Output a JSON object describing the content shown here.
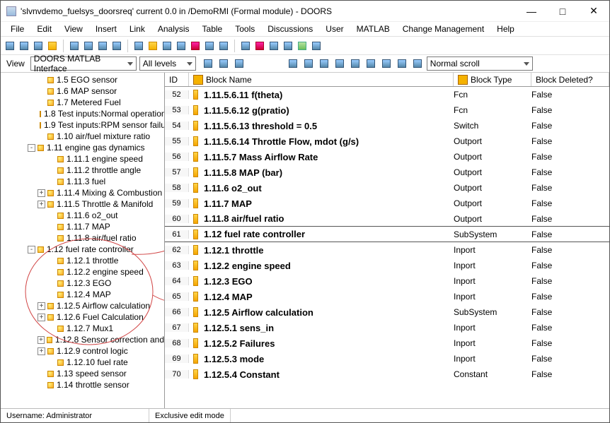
{
  "window": {
    "title": "'slvnvdemo_fuelsys_doorsreq' current 0.0 in /DemoRMI (Formal module) - DOORS"
  },
  "menu": [
    "File",
    "Edit",
    "View",
    "Insert",
    "Link",
    "Analysis",
    "Table",
    "Tools",
    "Discussions",
    "User",
    "MATLAB",
    "Change Management",
    "Help"
  ],
  "viewrow": {
    "view_label": "View",
    "view_combo": "DOORS MATLAB Interface",
    "level_combo": "All levels",
    "scroll_combo": "Normal scroll"
  },
  "tree": [
    {
      "indent": 3,
      "exp": "",
      "label": "1.5 EGO sensor"
    },
    {
      "indent": 3,
      "exp": "",
      "label": "1.6 MAP sensor"
    },
    {
      "indent": 3,
      "exp": "",
      "label": "1.7 Metered Fuel"
    },
    {
      "indent": 3,
      "exp": "",
      "label": "1.8 Test inputs:Normal operation"
    },
    {
      "indent": 3,
      "exp": "",
      "label": "1.9 Test inputs:RPM sensor failu"
    },
    {
      "indent": 3,
      "exp": "",
      "label": "1.10 air/fuel mixture ratio"
    },
    {
      "indent": 2,
      "exp": "-",
      "label": "1.11 engine gas dynamics"
    },
    {
      "indent": 4,
      "exp": "",
      "label": "1.11.1 engine speed"
    },
    {
      "indent": 4,
      "exp": "",
      "label": "1.11.2 throttle angle"
    },
    {
      "indent": 4,
      "exp": "",
      "label": "1.11.3 fuel"
    },
    {
      "indent": 3,
      "exp": "+",
      "label": "1.11.4 Mixing & Combustion"
    },
    {
      "indent": 3,
      "exp": "+",
      "label": "1.11.5 Throttle & Manifold"
    },
    {
      "indent": 4,
      "exp": "",
      "label": "1.11.6 o2_out"
    },
    {
      "indent": 4,
      "exp": "",
      "label": "1.11.7 MAP"
    },
    {
      "indent": 4,
      "exp": "",
      "label": "1.11.8 air/fuel ratio"
    },
    {
      "indent": 2,
      "exp": "-",
      "label": "1.12 fuel rate controller"
    },
    {
      "indent": 4,
      "exp": "",
      "label": "1.12.1 throttle"
    },
    {
      "indent": 4,
      "exp": "",
      "label": "1.12.2 engine speed"
    },
    {
      "indent": 4,
      "exp": "",
      "label": "1.12.3 EGO"
    },
    {
      "indent": 4,
      "exp": "",
      "label": "1.12.4 MAP"
    },
    {
      "indent": 3,
      "exp": "+",
      "label": "1.12.5 Airflow calculation"
    },
    {
      "indent": 3,
      "exp": "+",
      "label": "1.12.6 Fuel  Calculation"
    },
    {
      "indent": 4,
      "exp": "",
      "label": "1.12.7 Mux1"
    },
    {
      "indent": 3,
      "exp": "+",
      "label": "1.12.8 Sensor correction and"
    },
    {
      "indent": 3,
      "exp": "+",
      "label": "1.12.9 control logic"
    },
    {
      "indent": 4,
      "exp": "",
      "label": "1.12.10 fuel rate"
    },
    {
      "indent": 3,
      "exp": "",
      "label": "1.13 speed sensor"
    },
    {
      "indent": 3,
      "exp": "",
      "label": "1.14 throttle sensor"
    }
  ],
  "columns": {
    "id": "ID",
    "name": "Block Name",
    "type": "Block Type",
    "deleted": "Block Deleted?"
  },
  "rows": [
    {
      "id": 52,
      "name": "1.11.5.6.11 f(theta)",
      "type": "Fcn",
      "deleted": "False"
    },
    {
      "id": 53,
      "name": "1.11.5.6.12 g(pratio)",
      "type": "Fcn",
      "deleted": "False"
    },
    {
      "id": 54,
      "name": "1.11.5.6.13 threshold = 0.5",
      "type": "Switch",
      "deleted": "False"
    },
    {
      "id": 55,
      "name": "1.11.5.6.14 Throttle  Flow, mdot  (g/s)",
      "type": "Outport",
      "deleted": "False"
    },
    {
      "id": 56,
      "name": "1.11.5.7 Mass Airflow Rate",
      "type": "Outport",
      "deleted": "False"
    },
    {
      "id": 57,
      "name": "1.11.5.8 MAP (bar)",
      "type": "Outport",
      "deleted": "False"
    },
    {
      "id": 58,
      "name": "1.11.6 o2_out",
      "type": "Outport",
      "deleted": "False"
    },
    {
      "id": 59,
      "name": "1.11.7 MAP",
      "type": "Outport",
      "deleted": "False"
    },
    {
      "id": 60,
      "name": "1.11.8 air/fuel ratio",
      "type": "Outport",
      "deleted": "False",
      "sep": true
    },
    {
      "id": 61,
      "name": "1.12 fuel rate controller",
      "type": "SubSystem",
      "deleted": "False",
      "sep": true
    },
    {
      "id": 62,
      "name": "1.12.1 throttle",
      "type": "Inport",
      "deleted": "False"
    },
    {
      "id": 63,
      "name": "1.12.2 engine speed",
      "type": "Inport",
      "deleted": "False"
    },
    {
      "id": 64,
      "name": "1.12.3 EGO",
      "type": "Inport",
      "deleted": "False"
    },
    {
      "id": 65,
      "name": "1.12.4 MAP",
      "type": "Inport",
      "deleted": "False"
    },
    {
      "id": 66,
      "name": "1.12.5 Airflow calculation",
      "type": "SubSystem",
      "deleted": "False"
    },
    {
      "id": 67,
      "name": "1.12.5.1 sens_in",
      "type": "Inport",
      "deleted": "False"
    },
    {
      "id": 68,
      "name": "1.12.5.2 Failures",
      "type": "Inport",
      "deleted": "False"
    },
    {
      "id": 69,
      "name": "1.12.5.3 mode",
      "type": "Inport",
      "deleted": "False"
    },
    {
      "id": 70,
      "name": "1.12.5.4 Constant",
      "type": "Constant",
      "deleted": "False"
    }
  ],
  "status": {
    "user": "Username: Administrator",
    "mode": "Exclusive edit mode"
  }
}
